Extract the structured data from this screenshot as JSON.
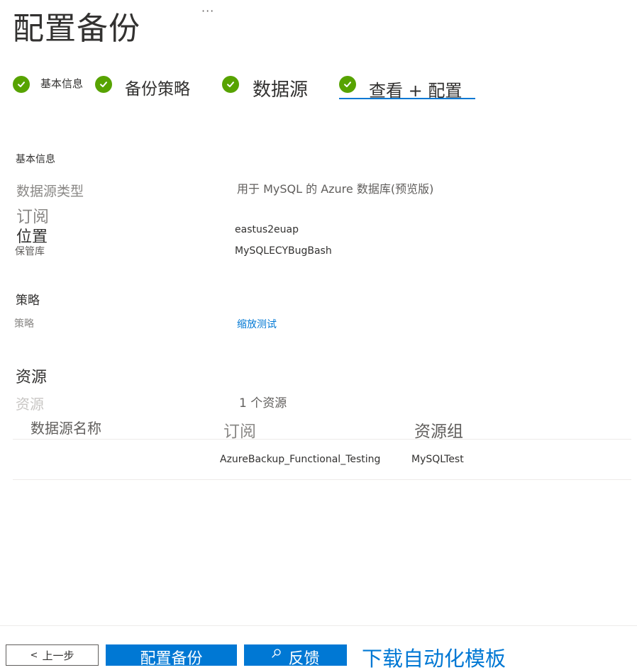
{
  "header": {
    "title": "配置备份",
    "more": "···"
  },
  "steps": [
    {
      "label": "基本信息",
      "status": "complete"
    },
    {
      "label": "备份策略",
      "status": "complete"
    },
    {
      "label": "数据源",
      "status": "complete"
    },
    {
      "label": "查看 + 配置",
      "status": "current"
    }
  ],
  "basics": {
    "title": "基本信息",
    "datasource_type_label": "数据源类型",
    "datasource_type_value": "用于 MySQL 的 Azure 数据库(预览版)",
    "subscription_label": "订阅",
    "location_label": "位置",
    "location_value": "eastus2euap",
    "vault_label": "保管库",
    "vault_value": "MySQLECYBugBash"
  },
  "policy": {
    "title": "策略",
    "policy_label": "策略",
    "policy_value": "缩放测试"
  },
  "resources": {
    "title": "资源",
    "resources_label": "资源",
    "resources_value": "1 个资源",
    "columns": [
      "数据源名称",
      "订阅",
      "资源组"
    ],
    "rows": [
      {
        "name": "",
        "subscription": "AzureBackup_Functional_Testing",
        "resource_group": "MySQLTest"
      }
    ]
  },
  "footer": {
    "prev_label": "上一步",
    "configure_label": "配置备份",
    "feedback_label": "反馈",
    "download_label": "下载自动化模板"
  },
  "colors": {
    "accent": "#0078d4",
    "success": "#57a300"
  }
}
